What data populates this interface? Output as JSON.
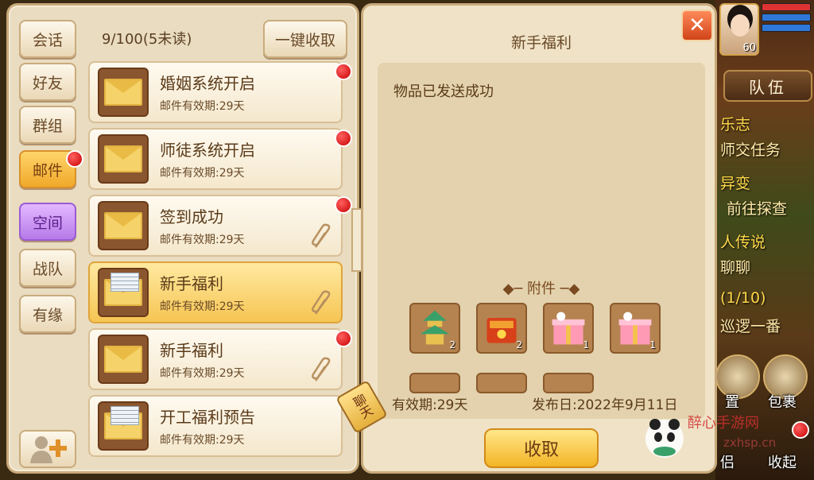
{
  "left": {
    "tabs": [
      "会话",
      "好友",
      "群组",
      "邮件",
      "空间",
      "战队",
      "有缘"
    ],
    "mail_count": "9/100(5未读)",
    "collect_all": "一键收取",
    "mails": [
      {
        "title": "婚姻系统开启",
        "expire": "邮件有效期:29天",
        "unread": true,
        "attachment": false,
        "opened": false
      },
      {
        "title": "师徒系统开启",
        "expire": "邮件有效期:29天",
        "unread": true,
        "attachment": false,
        "opened": false
      },
      {
        "title": "签到成功",
        "expire": "邮件有效期:29天",
        "unread": true,
        "attachment": true,
        "opened": false
      },
      {
        "title": "新手福利",
        "expire": "邮件有效期:29天",
        "unread": false,
        "attachment": true,
        "opened": true,
        "selected": true
      },
      {
        "title": "新手福利",
        "expire": "邮件有效期:29天",
        "unread": true,
        "attachment": true,
        "opened": false
      },
      {
        "title": "开工福利预告",
        "expire": "邮件有效期:29天",
        "unread": false,
        "attachment": false,
        "opened": true
      }
    ]
  },
  "detail": {
    "title": "新手福利",
    "body": "物品已发送成功",
    "attach_label": "附件",
    "items": [
      {
        "name": "pagoda-item",
        "qty": "2"
      },
      {
        "name": "red-treasure-item",
        "qty": "2"
      },
      {
        "name": "gift-box-item",
        "qty": "1"
      },
      {
        "name": "gift-box-item",
        "qty": "1"
      }
    ],
    "validity": "有效期:29天",
    "published": "发布日:2022年9月11日",
    "collect": "收取",
    "close": "✕"
  },
  "chat_tag": "聊天",
  "hud": {
    "level": "60",
    "team": "队伍",
    "lines": [
      "乐志",
      "师交任务",
      "异变",
      "前往探查",
      "人传说",
      "聊聊",
      "(1/10)",
      "巡逻一番"
    ],
    "set": "置",
    "bag": "包裹",
    "companion": "侣",
    "collapse": "收起"
  },
  "watermark": {
    "text": "醉心手游网",
    "url": "zxhsp.cn"
  }
}
